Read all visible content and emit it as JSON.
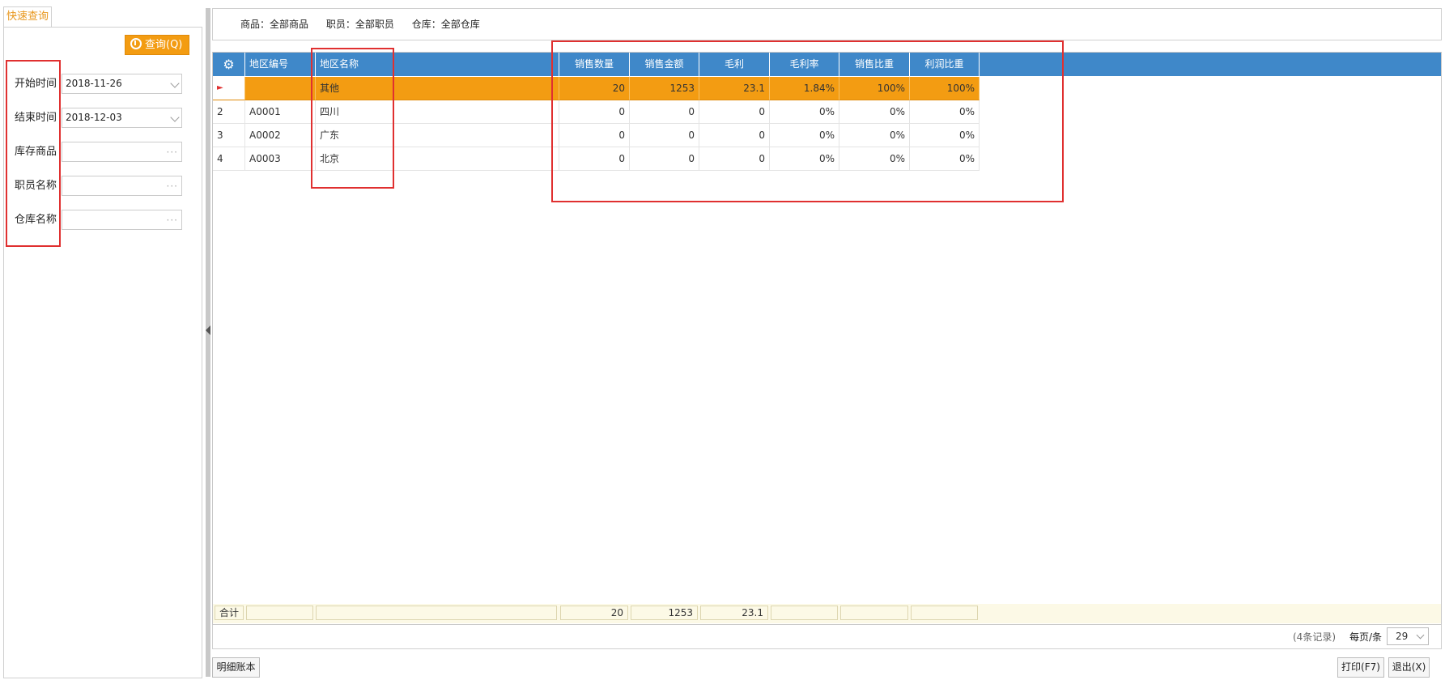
{
  "left_panel": {
    "tab_label": "快速查询",
    "query_button": "查询(Q)",
    "fields": [
      {
        "label": "开始时间",
        "value": "2018-11-26",
        "type": "dropdown"
      },
      {
        "label": "结束时间",
        "value": "2018-12-03",
        "type": "dropdown"
      },
      {
        "label": "库存商品",
        "value": "",
        "type": "picker"
      },
      {
        "label": "职员名称",
        "value": "",
        "type": "picker"
      },
      {
        "label": "仓库名称",
        "value": "",
        "type": "picker"
      }
    ],
    "picker_glyph": "···"
  },
  "filter_bar": {
    "goods": "商品：全部商品",
    "staff": "职员：全部职员",
    "warehouse": "仓库：全部仓库"
  },
  "grid": {
    "gear_icon": "⚙",
    "columns": [
      "地区编号",
      "地区名称",
      "销售数量",
      "销售金额",
      "毛利",
      "毛利率",
      "销售比重",
      "利润比重"
    ],
    "selected_marker": "►",
    "rows": [
      {
        "index": "",
        "code": "",
        "name": "其他",
        "qty": "20",
        "amount": "1253",
        "profit": "23.1",
        "profit_rate": "1.84%",
        "sales_share": "100%",
        "profit_share": "100%"
      },
      {
        "index": "2",
        "code": "A0001",
        "name": "四川",
        "qty": "0",
        "amount": "0",
        "profit": "0",
        "profit_rate": "0%",
        "sales_share": "0%",
        "profit_share": "0%"
      },
      {
        "index": "3",
        "code": "A0002",
        "name": "广东",
        "qty": "0",
        "amount": "0",
        "profit": "0",
        "profit_rate": "0%",
        "sales_share": "0%",
        "profit_share": "0%"
      },
      {
        "index": "4",
        "code": "A0003",
        "name": "北京",
        "qty": "0",
        "amount": "0",
        "profit": "0",
        "profit_rate": "0%",
        "sales_share": "0%",
        "profit_share": "0%"
      }
    ],
    "total": {
      "label": "合计",
      "qty": "20",
      "amount": "1253",
      "profit": "23.1"
    }
  },
  "pager": {
    "record_count": "(4条记录)",
    "per_page_label": "每页/条",
    "per_page_value": "29"
  },
  "buttons": {
    "detail": "明细账本",
    "print": "打印(F7)",
    "exit": "退出(X)"
  },
  "colors": {
    "header_blue": "#3f88c9",
    "selected_orange": "#f39c12",
    "highlight_red": "#e03030",
    "total_row_bg": "#fcf9e6"
  }
}
